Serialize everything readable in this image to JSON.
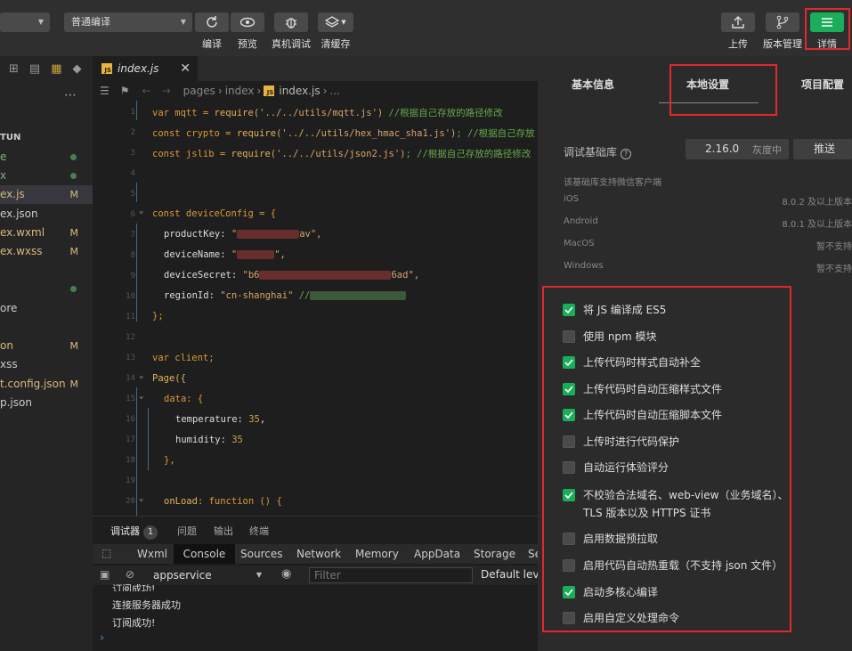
{
  "toolbar": {
    "compile_mode": "普通编译",
    "compile_label": "编译",
    "preview_label": "预览",
    "remote_debug_label": "真机调试",
    "clear_cache_label": "清缓存",
    "upload_label": "上传",
    "version_label": "版本管理",
    "details_label": "详情"
  },
  "explorer": {
    "folder": "TUN",
    "files": [
      {
        "name": "e",
        "status": "dot"
      },
      {
        "name": "x",
        "status": "dot"
      },
      {
        "name": "ex.js",
        "status": "M"
      },
      {
        "name": "ex.json",
        "status": ""
      },
      {
        "name": "ex.wxml",
        "status": "M"
      },
      {
        "name": "ex.wxss",
        "status": "M"
      },
      {
        "name": "",
        "status": ""
      },
      {
        "name": "",
        "status": "dot"
      },
      {
        "name": "ore",
        "status": ""
      },
      {
        "name": "",
        "status": ""
      },
      {
        "name": "on",
        "status": "M"
      },
      {
        "name": "xss",
        "status": ""
      },
      {
        "name": "t.config.json",
        "status": "M"
      },
      {
        "name": "p.json",
        "status": ""
      }
    ]
  },
  "editor": {
    "tab_name": "index.js",
    "breadcrumb": [
      "pages",
      "index",
      "index.js",
      "..."
    ],
    "code": {
      "l1_a": "var mqtt = ",
      "l1_fn": "require",
      "l1_s": "('../../utils/mqtt.js')",
      "l1_c": " //根据自己存放的路径修改",
      "l2_a": "const crypto = ",
      "l2_fn": "require",
      "l2_s": "('../../utils/hex_hmac_sha1.js')",
      "l2_c": "; //根据自己存放",
      "l3_a": "const jslib = ",
      "l3_fn": "require",
      "l3_s": "('../../utils/json2.js')",
      "l3_c": "; //根据自己存放的路径修改",
      "l6": "const deviceConfig = {",
      "l7_k": "productKey: ",
      "l7_v1": "\"",
      "l7_v2": "av\",",
      "l8_k": "deviceName: ",
      "l8_v1": "\"",
      "l8_v2": "\",",
      "l9_k": "deviceSecret: ",
      "l9_v1": "\"b6",
      "l9_v2": "6ad\",",
      "l10_k": "regionId: ",
      "l10_v": "\"cn-shanghai\"",
      "l10_c": " //",
      "l11": "};",
      "l13": "var client;",
      "l14": "Page({",
      "l15": "data: {",
      "l16_k": "temperature: ",
      "l16_v": "35",
      "l17_k": "humidity: ",
      "l17_v": "35",
      "l18": "},",
      "l20_k": "onLoad",
      "l20_r": ": function () {"
    },
    "line_numbers": [
      "1",
      "2",
      "3",
      "4",
      "5",
      "6",
      "7",
      "8",
      "9",
      "10",
      "11",
      "12",
      "13",
      "14",
      "15",
      "16",
      "17",
      "18",
      "19",
      "20"
    ]
  },
  "debug": {
    "tabs": [
      "调试器",
      "问题",
      "输出",
      "终端"
    ],
    "badge": "1",
    "devtools_tabs": [
      "Wxml",
      "Console",
      "Sources",
      "Network",
      "Memory",
      "AppData",
      "Storage",
      "Se"
    ],
    "context": "appservice",
    "filter_placeholder": "Filter",
    "levels": "Default level",
    "lines": [
      "订阅成功!",
      "连接服务器成功",
      "订阅成功!"
    ],
    "prompt": "›"
  },
  "details": {
    "tabs": [
      "基本信息",
      "本地设置",
      "项目配置"
    ],
    "base_lib_label": "调试基础库",
    "base_lib_version": "2.16.0",
    "base_lib_status": "灰度中",
    "push_label": "推送",
    "support_title": "该基础库支持微信客户端",
    "platforms": [
      {
        "name": "iOS",
        "value": "8.0.2 及以上版本"
      },
      {
        "name": "Android",
        "value": "8.0.1 及以上版本"
      },
      {
        "name": "MacOS",
        "value": "暂不支持"
      },
      {
        "name": "Windows",
        "value": "暂不支持"
      }
    ],
    "options": [
      {
        "label": "将 JS 编译成 ES5",
        "checked": true
      },
      {
        "label": "使用 npm 模块",
        "checked": false
      },
      {
        "label": "上传代码时样式自动补全",
        "checked": true
      },
      {
        "label": "上传代码时自动压缩样式文件",
        "checked": true
      },
      {
        "label": "上传代码时自动压缩脚本文件",
        "checked": true
      },
      {
        "label": "上传时进行代码保护",
        "checked": false
      },
      {
        "label": "自动运行体验评分",
        "checked": false
      },
      {
        "label": "不校验合法域名、web-view（业务域名）、TLS 版本以及 HTTPS 证书",
        "checked": true
      },
      {
        "label": "启用数据预拉取",
        "checked": false
      },
      {
        "label": "启用代码自动热重载（不支持 json 文件）",
        "checked": false
      },
      {
        "label": "启动多核心编译",
        "checked": true
      },
      {
        "label": "启用自定义处理命令",
        "checked": false
      }
    ]
  },
  "colors": {
    "accent": "#1aad5a",
    "highlight": "#e0292b"
  }
}
